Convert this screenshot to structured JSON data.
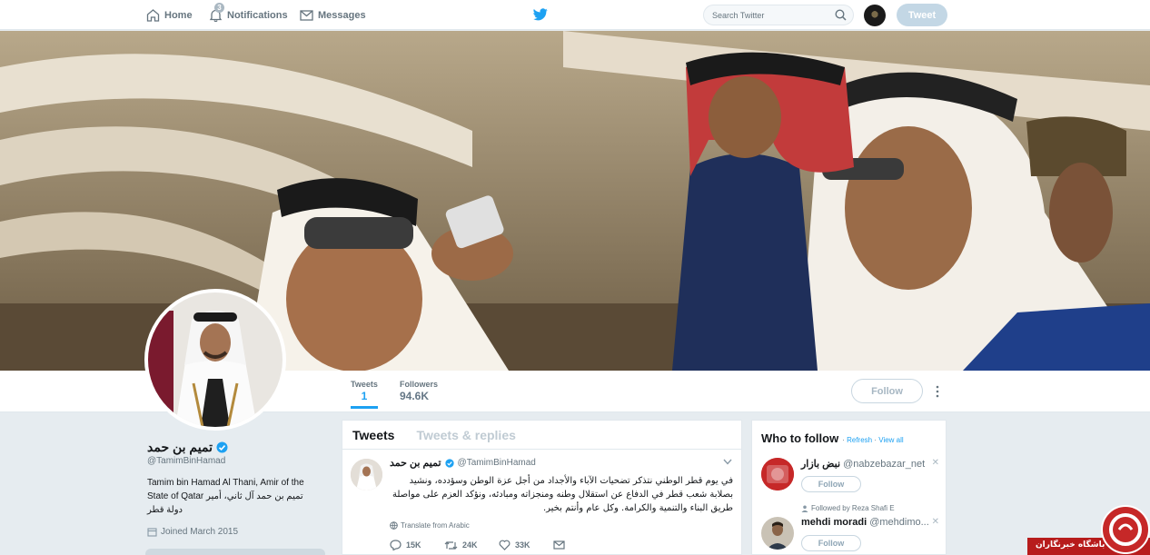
{
  "nav": {
    "home_label": "Home",
    "notifications_label": "Notifications",
    "notifications_count": "3",
    "messages_label": "Messages",
    "search_placeholder": "Search Twitter",
    "tweet_button": "Tweet"
  },
  "profile": {
    "name": "تميم بن حمد",
    "handle": "@TamimBinHamad",
    "bio": "Tamim bin Hamad Al Thani, Amir of the State of Qatar تميم بن حمد آل ثاني، أمير دولة قطر",
    "joined": "Joined March 2015",
    "stats": [
      {
        "label": "Tweets",
        "value": "1"
      },
      {
        "label": "Followers",
        "value": "94.6K"
      }
    ],
    "follow_button": "Follow"
  },
  "timeline": {
    "tabs": [
      "Tweets",
      "Tweets & replies"
    ],
    "tweet": {
      "author_name": "تميم بن حمد",
      "author_handle": "@TamimBinHamad",
      "text": "في يوم قطر الوطني نتذكر تضحيات الآباء والأجداد من أجل عزة الوطن وسؤدده، ونشيد بصلابة شعب قطر في الدفاع عن استقلال وطنه ومنجزاته ومبادئه، ونؤكد العزم على مواصلة طريق البناء والتنمية والكرامة. وكل عام وأنتم بخير.",
      "translate": "Translate from Arabic",
      "replies": "15K",
      "retweets": "24K",
      "likes": "33K"
    }
  },
  "who_to_follow": {
    "title": "Who to follow",
    "refresh": "Refresh",
    "view_all": "View all",
    "separator": "·",
    "suggestions": [
      {
        "name": "نبض بازار",
        "handle": "@nabzebazar_net",
        "button": "Follow",
        "context": ""
      },
      {
        "name": "mehdi moradi",
        "handle": "@mehdimo...",
        "button": "Follow",
        "context": "Followed by Reza Shafi E"
      }
    ]
  },
  "watermark": {
    "text": "باشگاه خبرنگاران"
  },
  "colors": {
    "accent": "#1da1f2",
    "background": "#e6ecf0",
    "watermark_red": "#b71c1c"
  }
}
